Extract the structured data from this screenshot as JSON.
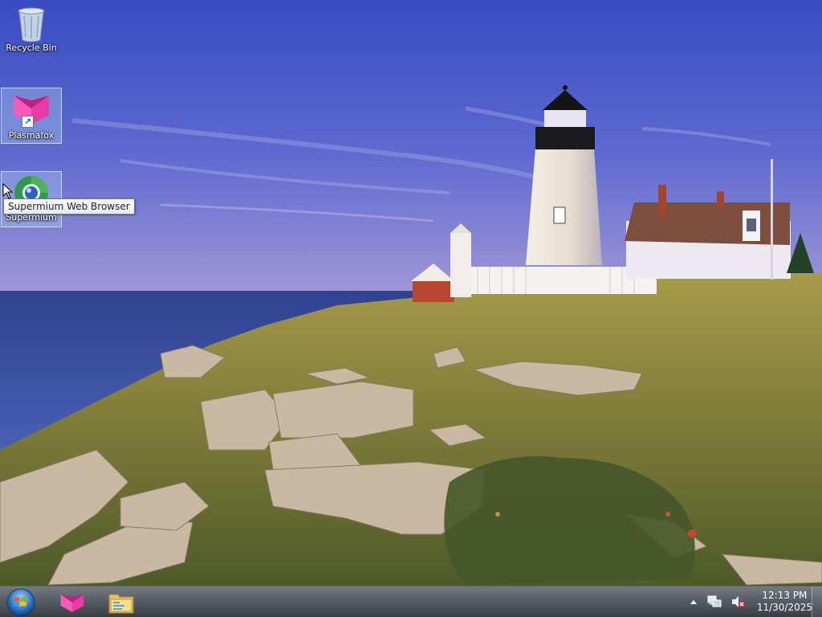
{
  "desktop": {
    "icons": [
      {
        "name": "recycle-bin",
        "label": "Recycle Bin"
      },
      {
        "name": "plasmafox",
        "label": "Plasmafox"
      },
      {
        "name": "supermium",
        "label": "Supermium"
      }
    ],
    "tooltip": "Supermium Web Browser"
  },
  "taskbar": {
    "pinned": [
      "plasmafox-icon",
      "file-explorer-icon"
    ],
    "tray_icons": [
      "show-hidden-icons-arrow-icon",
      "network-icon",
      "volume-muted-icon"
    ],
    "clock": {
      "time": "12:13 PM",
      "date": "11/30/2025"
    }
  },
  "colors": {
    "sky_top": "#3c4fc4",
    "sky_horizon": "#8b8fd8",
    "sea": "#2c3f8e",
    "grass": "#8a8a3c",
    "plasmafox_brand": "#e83ca6",
    "taskbar": "#1a2028"
  }
}
